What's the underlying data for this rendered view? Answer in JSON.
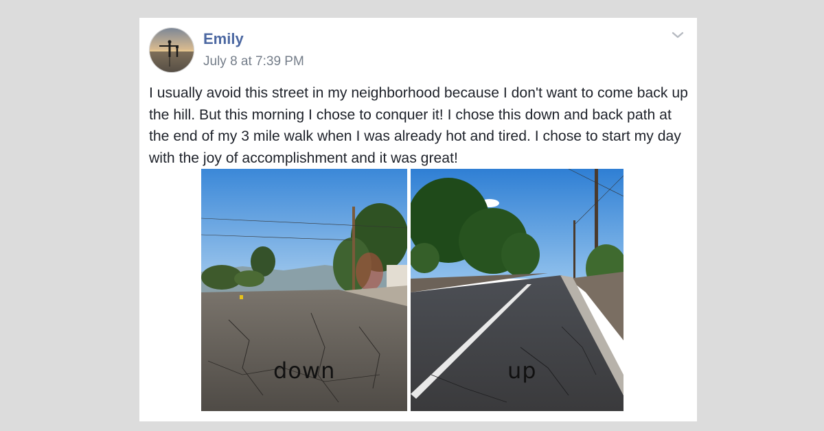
{
  "post": {
    "author_name": "Emily",
    "timestamp": "July 8 at 7:39 PM",
    "body_text": "I usually avoid this street in my neighborhood because I don't want to come back up the hill. But this morning I chose to conquer it! I chose this down and back path at the end of my 3 mile walk when I was already hot and tired. I chose to start my day with the joy of accomplishment and it was great!",
    "options_icon": "chevron-down-icon",
    "avatar_icon": "profile-photo",
    "photos": [
      {
        "caption": "down"
      },
      {
        "caption": "up"
      }
    ]
  },
  "colors": {
    "author_link": "#4b67a1",
    "timestamp": "#747d89",
    "body_text": "#1d2129",
    "page_background": "#dcdcdc",
    "card_background": "#ffffff"
  }
}
